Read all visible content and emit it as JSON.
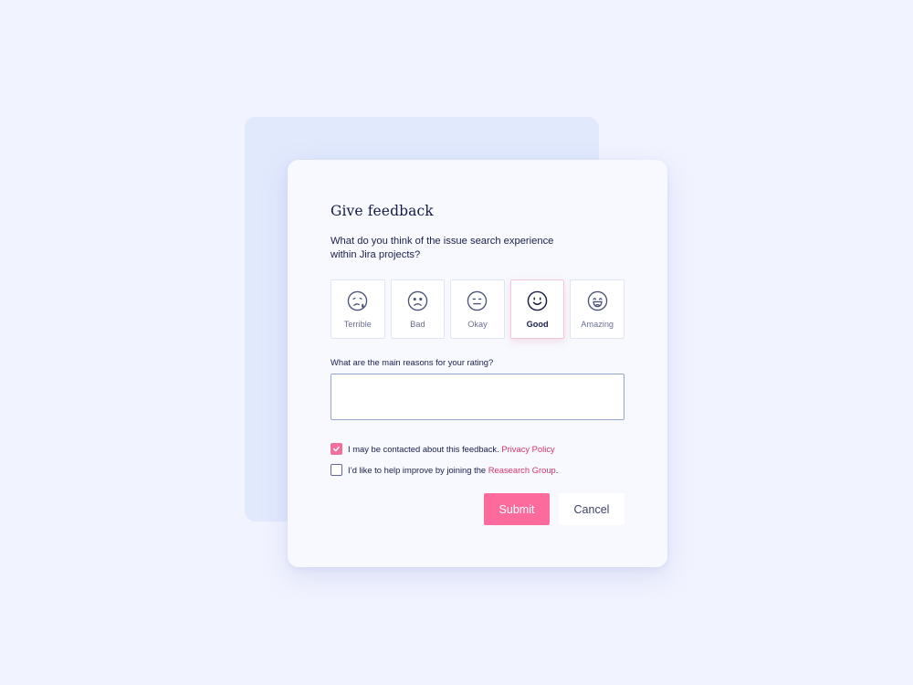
{
  "dialog": {
    "title": "Give feedback",
    "question": "What do you think of the issue search experience within Jira projects?",
    "ratings": [
      {
        "label": "Terrible",
        "icon": "terrible-face-icon"
      },
      {
        "label": "Bad",
        "icon": "bad-face-icon"
      },
      {
        "label": "Okay",
        "icon": "okay-face-icon"
      },
      {
        "label": "Good",
        "icon": "good-face-icon"
      },
      {
        "label": "Amazing",
        "icon": "amazing-face-icon"
      }
    ],
    "selected_rating": "Good",
    "reason_label": "What are the main reasons for your rating?",
    "reason_value": "",
    "consent_contact": {
      "checked": true,
      "text": "I may be contacted about this feedback.",
      "link": "Privacy Policy",
      "suffix": ""
    },
    "consent_research": {
      "checked": false,
      "text": "I’d like to help improve by joining the",
      "link": "Reasearch Group",
      "suffix": "."
    },
    "submit_label": "Submit",
    "cancel_label": "Cancel"
  },
  "colors": {
    "background": "#f1f4fe",
    "accent": "#fc6b9b",
    "link": "#d9346b",
    "text": "#1b1f4b"
  }
}
